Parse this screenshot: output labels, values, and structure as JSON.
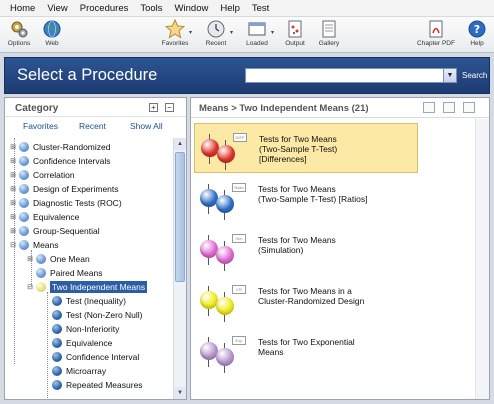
{
  "menu": [
    "Home",
    "View",
    "Procedures",
    "Tools",
    "Window",
    "Help",
    "Test"
  ],
  "toolbar": {
    "options": "Options",
    "web": "Web",
    "favorites": "Favorites",
    "recent": "Recent",
    "loaded": "Loaded",
    "output": "Output",
    "gallery": "Gallery",
    "chapter_pdf": "Chapter PDF",
    "help": "Help"
  },
  "banner": {
    "title": "Select a Procedure",
    "search_value": "",
    "search_button": "Search"
  },
  "category": {
    "title": "Category",
    "expand_all": "+",
    "collapse_all": "−",
    "tabs": {
      "favorites": "Favorites",
      "recent": "Recent",
      "show_all": "Show All"
    },
    "tree": {
      "cluster": "Cluster-Randomized",
      "confidence": "Confidence Intervals",
      "correlation": "Correlation",
      "doe": "Design of Experiments",
      "diagnostic": "Diagnostic Tests (ROC)",
      "equivalence": "Equivalence",
      "group_seq": "Group-Sequential",
      "means": "Means",
      "one_mean": "One Mean",
      "paired": "Paired Means",
      "two_indep": "Two Independent Means",
      "test_ineq": "Test (Inequality)",
      "test_nzn": "Test (Non-Zero Null)",
      "noninf": "Non-Inferiority",
      "equiv2": "Equivalence",
      "ci2": "Confidence Interval",
      "microarray": "Microarray",
      "repeated": "Repeated Measures"
    }
  },
  "results": {
    "header": "Means > Two Independent Means (21)",
    "items": [
      {
        "label": "Tests for Two Means\n(Two-Sample T-Test)\n[Differences]",
        "color": "#e0342a",
        "tag": "DIFF"
      },
      {
        "label": "Tests for Two Means\n(Two-Sample T-Test) [Ratios]",
        "color": "#2f6fc9",
        "tag": "Ratio"
      },
      {
        "label": "Tests for Two Means\n(Simulation)",
        "color": "#e06ad6",
        "tag": "Sim"
      },
      {
        "label": "Tests for Two Means in a\nCluster-Randomized Design",
        "color": "#f2ec1c",
        "tag": "CR"
      },
      {
        "label": "Tests for Two Exponential\nMeans",
        "color": "#b796cf",
        "tag": "Exp"
      }
    ]
  }
}
